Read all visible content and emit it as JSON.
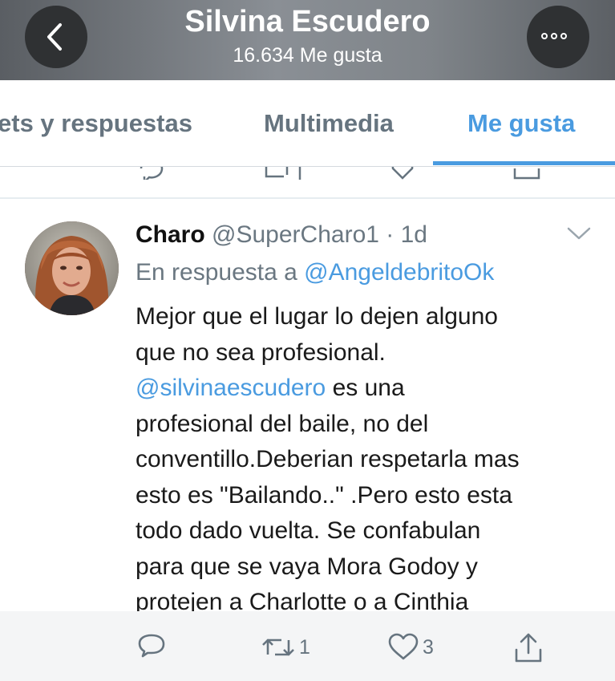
{
  "header": {
    "title": "Silvina Escudero",
    "subtitle": "16.634 Me gusta",
    "back_icon": "chevron-left-icon",
    "more_icon": "more-options-icon",
    "background": "#7d8287"
  },
  "tabs": [
    {
      "label": "ets y respuestas",
      "active": false
    },
    {
      "label": "Multimedia",
      "active": false
    },
    {
      "label": "Me gusta",
      "active": true
    }
  ],
  "accent_color": "#4a9be0",
  "tweet": {
    "author_name": "Charo",
    "handle": "@SuperCharo1",
    "separator": "·",
    "time": "1d",
    "reply_prefix": "En respuesta a",
    "reply_to": "@AngeldebritoOk",
    "lines": {
      "l1": "Mejor que el lugar lo dejen alguno",
      "l2": "que no sea profesional.",
      "l3_mention": "@silvinaescudero",
      "l3_rest": " es una",
      "l4": "profesional del baile, no del",
      "l5": "conventillo.Deberian respetarla mas",
      "l6": "esto es \"Bailando..\" .Pero esto esta",
      "l7": "todo dado vuelta. Se confabulan",
      "l8": "para que se vaya Mora Godoy y",
      "l9": "protejen a Charlotte o a Cinthia"
    },
    "actions": {
      "reply_icon": "reply-icon",
      "retweet_icon": "retweet-icon",
      "retweet_count": "1",
      "like_icon": "heart-icon",
      "like_count": "3",
      "share_icon": "share-icon"
    }
  }
}
